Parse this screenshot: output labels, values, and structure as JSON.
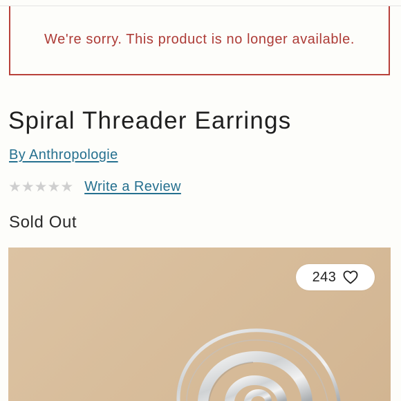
{
  "alert": {
    "message": "We're sorry. This product is no longer available."
  },
  "product": {
    "title": "Spiral Threader Earrings",
    "brand_link": "By Anthropologie",
    "rating": {
      "stars_filled": 0,
      "stars_total": 5,
      "review_link": "Write a Review"
    },
    "status": "Sold Out",
    "likes": {
      "count": "243"
    }
  },
  "colors": {
    "alert_red": "#ad3b36",
    "link_blue": "#25708f",
    "star_empty": "#cfcfcf",
    "image_background": "#d8bd9b"
  },
  "icons": {
    "star": "star-icon",
    "heart": "heart-icon"
  }
}
